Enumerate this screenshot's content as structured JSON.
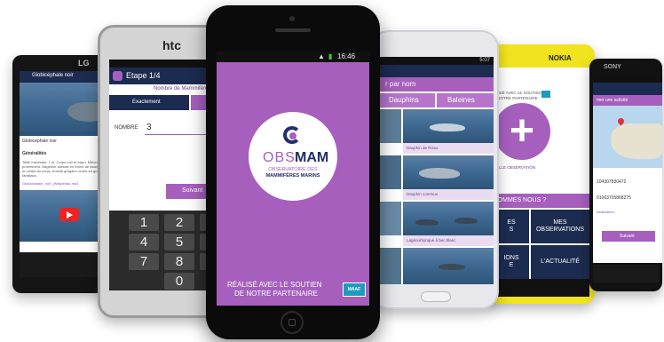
{
  "phone_lg": {
    "brand": "LG",
    "header_title": "Globicéphale noir",
    "photo_caption": "Globicéphale noir",
    "section_label": "Généralités",
    "body_text": "Taille maximale: 7 m. Corps noir et trapu. Melon proéminent. Nageoire dorsale en forme de faucille, située en avant du corps. Animal grégaire vivant en groupes familiaux.",
    "link_label": "Globicéphale_noir_(Wikipedia).mp4"
  },
  "phone_htc": {
    "brand": "htc",
    "step_title": "Etape 1/4",
    "header_line": "Nombre de Mammifères",
    "tab_exact": "Exactement",
    "field_label": "NOMBRE",
    "field_value": "3",
    "next_button": "Suivant",
    "keypad": [
      [
        "1",
        "2",
        "3"
      ],
      [
        "4",
        "5",
        "6"
      ],
      [
        "7",
        "8",
        "9"
      ],
      [
        "",
        "0",
        ""
      ]
    ]
  },
  "phone_center": {
    "status_time": "16:46",
    "logo_obs": "OBS",
    "logo_mam": "MAM",
    "logo_line1": "OBSERVATOIRE DES",
    "logo_line2": "MAMMIFÈRES MARINS",
    "footer_line1": "RÉALISÉ AVEC LE SOUTIEN",
    "footer_line2": "DE NOTRE PARTENAIRE",
    "partner_logo": "MAAF"
  },
  "phone_samsung": {
    "status_time": "5:07",
    "header_text": "r par nom",
    "tab_dauphins": "Dauphins",
    "tab_baleines": "Baleines",
    "species": [
      "Dauphin de Risso",
      "Dauphin commun",
      "Lagénorhynque à bec blanc",
      ""
    ]
  },
  "phone_nokia": {
    "brand": "NOKIA",
    "support_line1": "ALISÉ AVEC LE SOUTIEN",
    "support_line2": "E NOTRE PARTENAIRE",
    "plus_glyph": "+",
    "new_obs_label": "VELLE OBSERVATION",
    "who_label": "SOMMES NOUS ?",
    "tile_left_top": "ES\nS",
    "tile_mes_obs": "MES\nOBSERVATIONS",
    "tile_left_bottom": "IONS\nE",
    "tile_actualite": "L'ACTUALITÉ"
  },
  "phone_sony": {
    "brand": "SONY",
    "status_time": "11:36",
    "header_text": "mer une activité",
    "coord_1": "104307830472",
    "coord_2": "01063705868275",
    "small_label": "localisation",
    "next_button": "Suivant"
  },
  "colors": {
    "accent": "#a65fbd",
    "dark_nav": "#1c2b50",
    "partner": "#1d9bbf"
  }
}
